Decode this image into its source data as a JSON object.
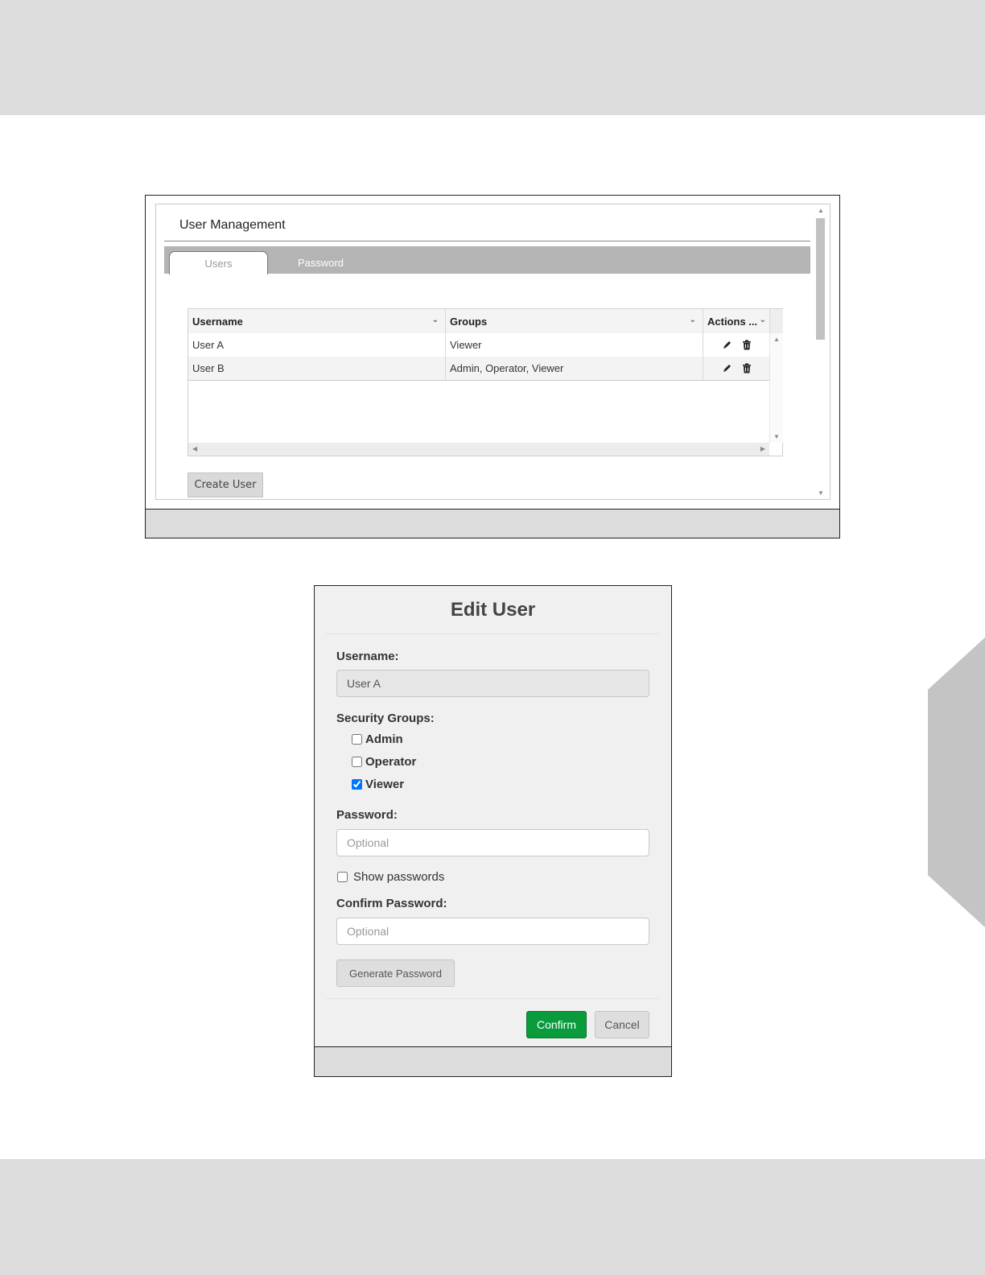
{
  "user_management": {
    "title": "User Management",
    "tabs": [
      {
        "label": "Users",
        "active": true
      },
      {
        "label": "Password",
        "active": false
      }
    ],
    "grid": {
      "columns": [
        "Username",
        "Groups",
        "Actions ..."
      ],
      "rows": [
        {
          "username": "User A",
          "groups": "Viewer",
          "actions": [
            "edit-icon",
            "trash-icon"
          ]
        },
        {
          "username": "User B",
          "groups": "Admin, Operator, Viewer",
          "actions": [
            "edit-icon",
            "trash-icon"
          ]
        }
      ]
    },
    "create_button": "Create User"
  },
  "edit_user": {
    "title": "Edit User",
    "username_label": "Username:",
    "username_value": "User A",
    "groups_label": "Security Groups:",
    "groups": [
      {
        "label": "Admin",
        "checked": false
      },
      {
        "label": "Operator",
        "checked": false
      },
      {
        "label": "Viewer",
        "checked": true
      }
    ],
    "password_label": "Password:",
    "password_placeholder": "Optional",
    "show_passwords_label": "Show passwords",
    "show_passwords_checked": false,
    "confirm_label": "Confirm Password:",
    "confirm_placeholder": "Optional",
    "generate_button": "Generate Password",
    "confirm_button": "Confirm",
    "cancel_button": "Cancel"
  },
  "colors": {
    "confirm_green": "#0a9b3d",
    "tab_bar_gray": "#b4b4b4",
    "page_band_gray": "#dddcdd"
  }
}
